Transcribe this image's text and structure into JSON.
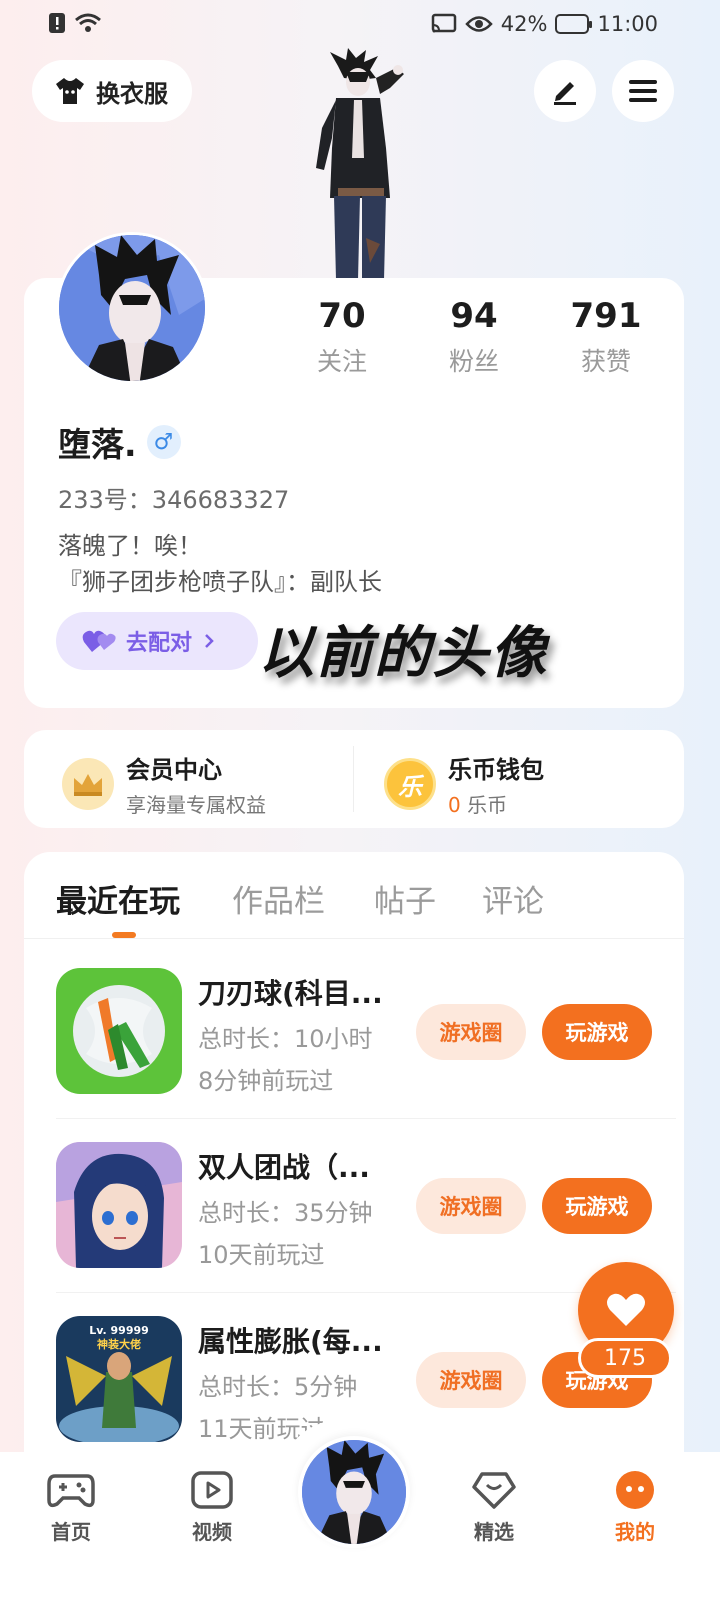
{
  "status_bar": {
    "battery": "42%",
    "time": "11:00"
  },
  "top": {
    "outfit_label": "换衣服"
  },
  "profile": {
    "stats": [
      {
        "value": "70",
        "label": "关注"
      },
      {
        "value": "94",
        "label": "粉丝"
      },
      {
        "value": "791",
        "label": "获赞"
      }
    ],
    "name": "堕落.",
    "gender_symbol": "♂",
    "uid": "233号：346683327",
    "bio_line1": "落魄了！唉！",
    "bio_line2": "『狮子团步枪喷子队』：副队长",
    "match_label": "去配对",
    "overlay_text": "以前的头像"
  },
  "member": {
    "vip_title": "会员中心",
    "vip_sub": "享海量专属权益",
    "wallet_title": "乐币钱包",
    "wallet_icon_char": "乐",
    "wallet_amount": "0",
    "wallet_unit": "乐币"
  },
  "tabs": [
    "最近在玩",
    "作品栏",
    "帖子",
    "评论"
  ],
  "games": [
    {
      "title": "刀刃球(科目...",
      "duration": "总时长：10小时",
      "last": "8分钟前玩过"
    },
    {
      "title": "双人团战（...",
      "duration": "总时长：35分钟",
      "last": "10天前玩过"
    },
    {
      "title": "属性膨胀(每...",
      "duration": "总时长：5分钟",
      "last": "11天前玩过",
      "icon_text_1": "Lv. 99999",
      "icon_text_2": "神装大佬"
    }
  ],
  "game_buttons": {
    "circle": "游戏圈",
    "play": "玩游戏"
  },
  "like": {
    "count": "175"
  },
  "nav": {
    "home": "首页",
    "video": "视频",
    "featured": "精选",
    "mine": "我的"
  },
  "colors": {
    "accent": "#f3701f",
    "match_purple": "#7b5ee6",
    "gender_blue": "#3b8ae6"
  }
}
